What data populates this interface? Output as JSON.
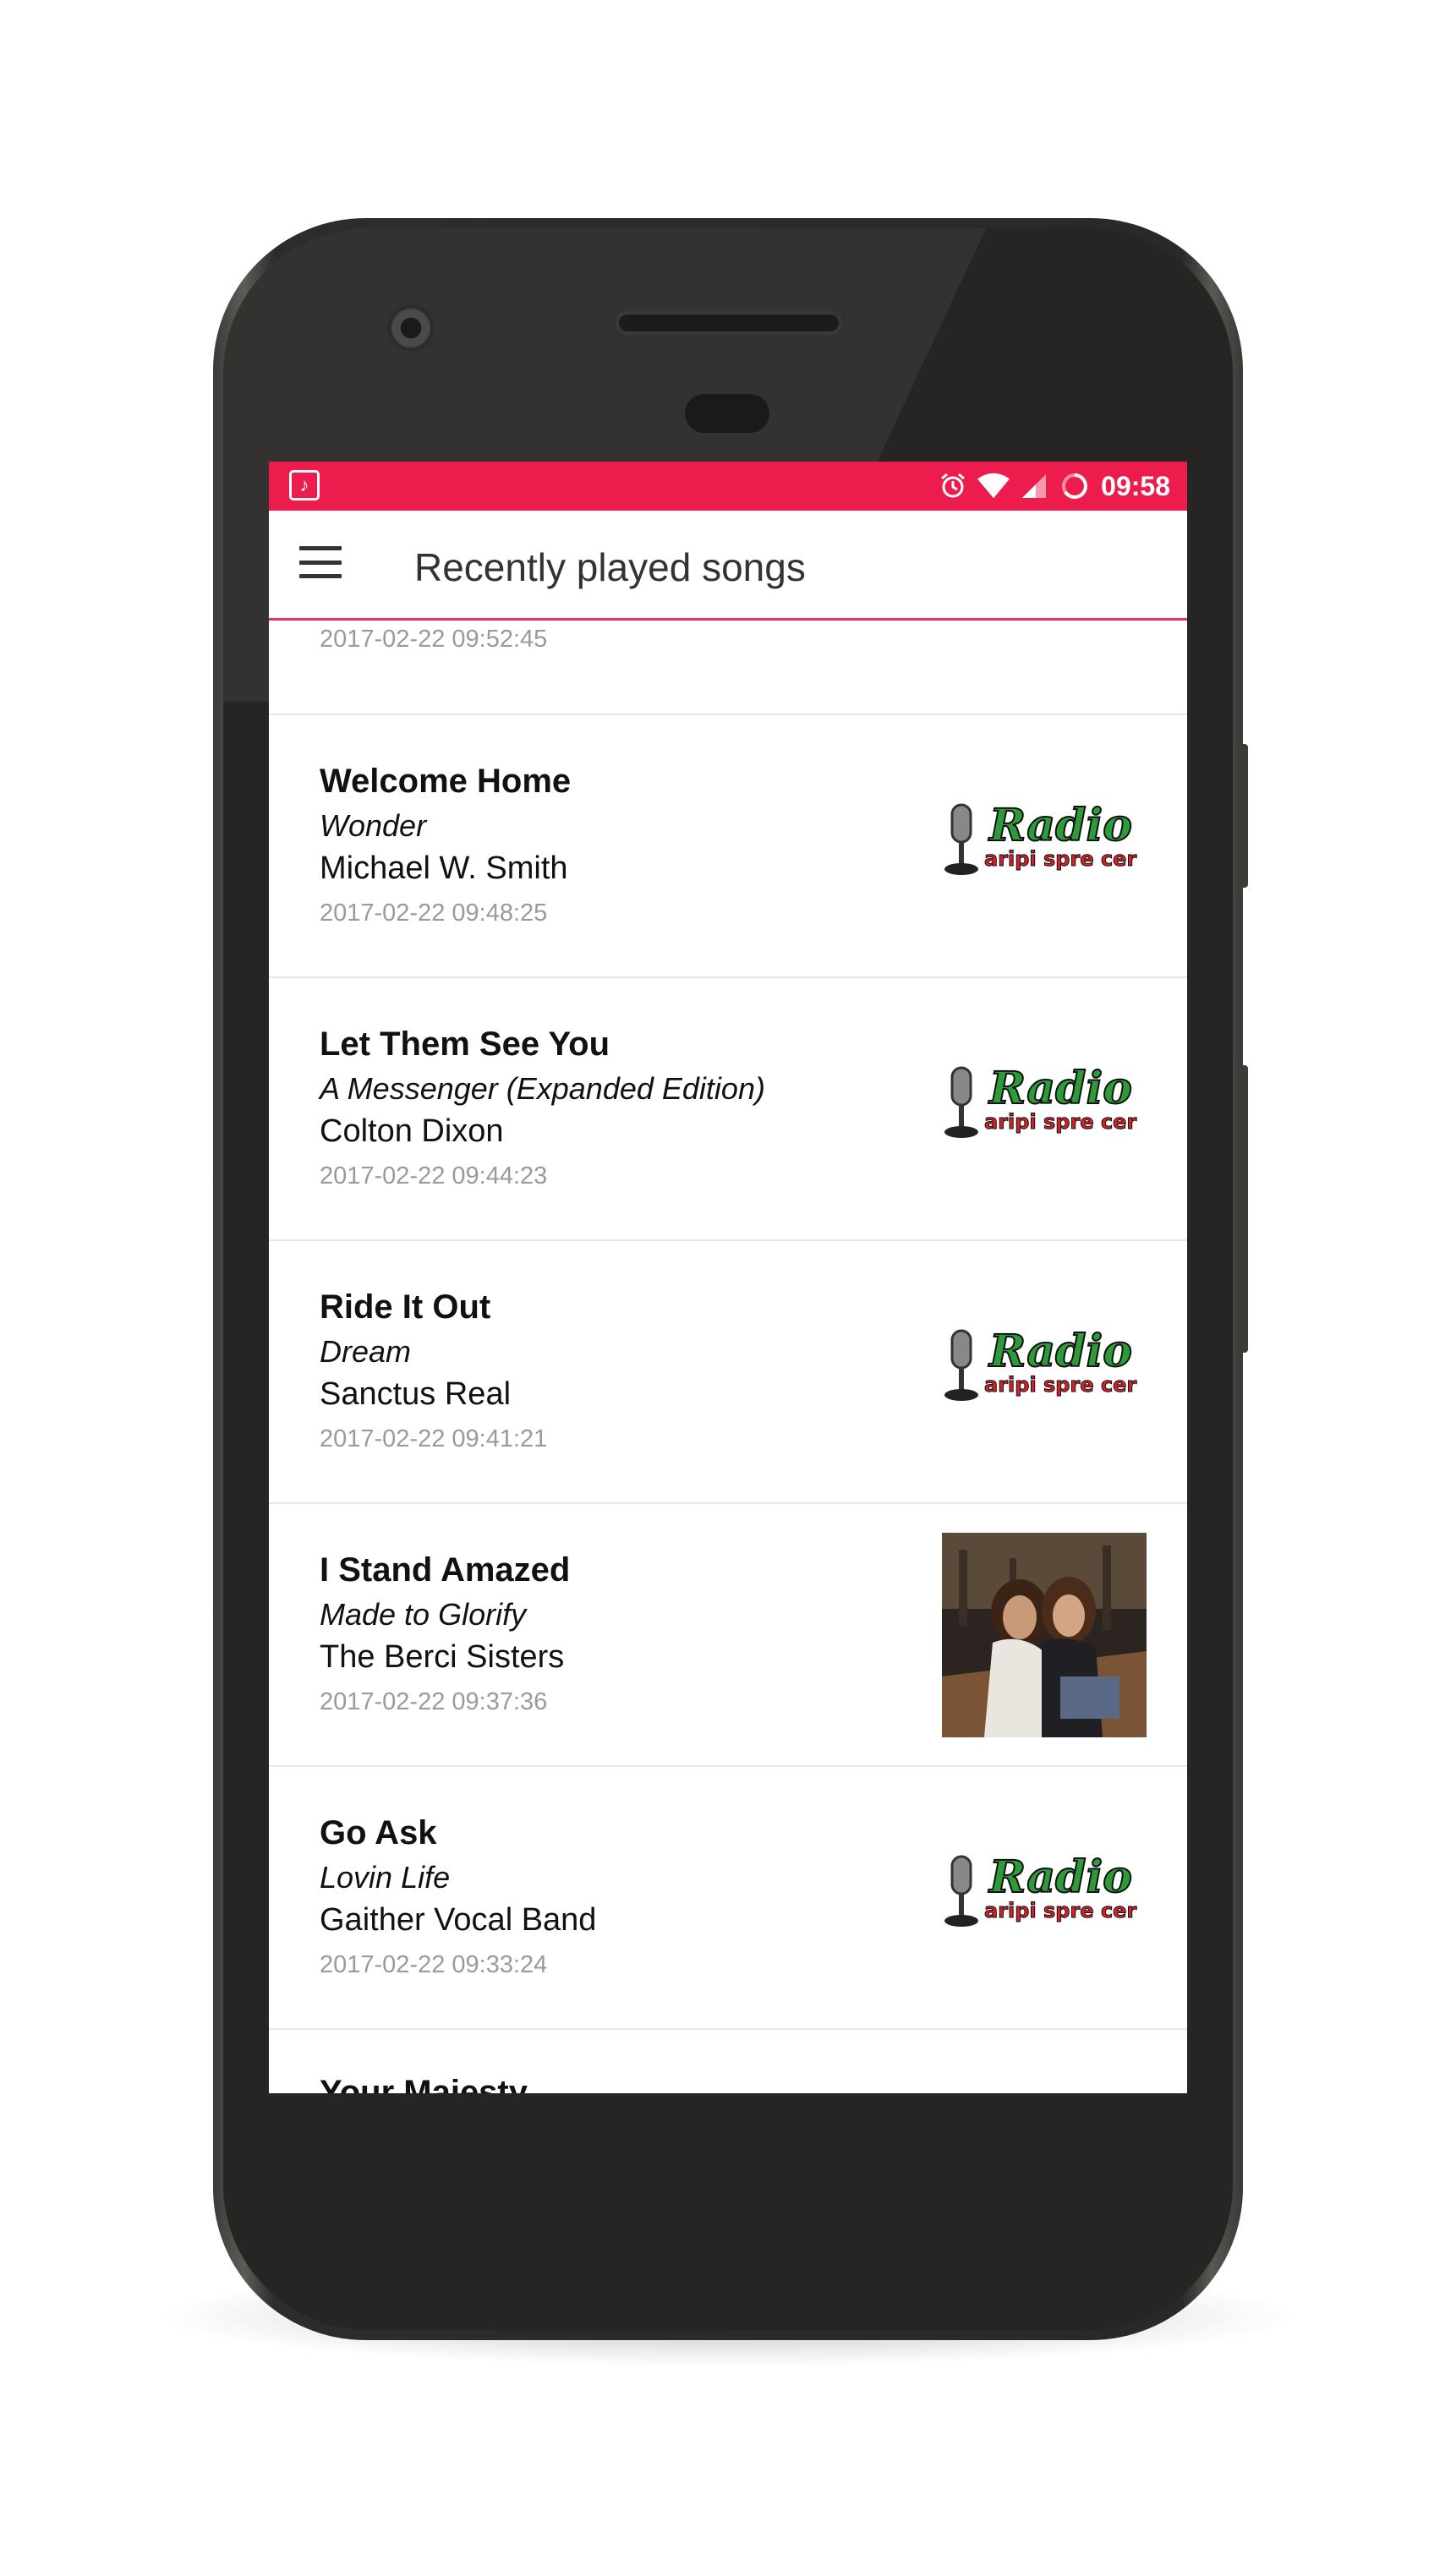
{
  "status_bar": {
    "time": "09:58",
    "icons": [
      "music-app-icon",
      "alarm-icon",
      "wifi-icon",
      "signal-icon",
      "battery-icon"
    ],
    "color": "#ec1c4d"
  },
  "app_bar": {
    "title": "Recently played songs",
    "menu_icon": "hamburger-menu-icon",
    "accent": "#e0375a"
  },
  "songs": [
    {
      "date": "2017-02-22 09:52:45"
    },
    {
      "title": "Welcome Home",
      "album": "Wonder",
      "artist": "Michael W. Smith",
      "date": "2017-02-22 09:48:25",
      "art": "radio-logo",
      "logo_text": "Radio",
      "logo_sub": "aripi spre cer"
    },
    {
      "title": "Let Them See You",
      "album": "A Messenger (Expanded Edition)",
      "artist": "Colton Dixon",
      "date": "2017-02-22 09:44:23",
      "art": "radio-logo",
      "logo_text": "Radio",
      "logo_sub": "aripi spre cer"
    },
    {
      "title": "Ride It Out",
      "album": "Dream",
      "artist": "Sanctus Real",
      "date": "2017-02-22 09:41:21",
      "art": "radio-logo",
      "logo_text": "Radio",
      "logo_sub": "aripi spre cer"
    },
    {
      "title": "I Stand Amazed",
      "album": "Made to Glorify",
      "artist": "The Berci Sisters",
      "date": "2017-02-22 09:37:36",
      "art": "album-cover"
    },
    {
      "title": "Go Ask",
      "album": "Lovin Life",
      "artist": "Gaither Vocal Band",
      "date": "2017-02-22 09:33:24",
      "art": "radio-logo",
      "logo_text": "Radio",
      "logo_sub": "aripi spre cer"
    },
    {
      "title": "Your Majesty"
    }
  ]
}
